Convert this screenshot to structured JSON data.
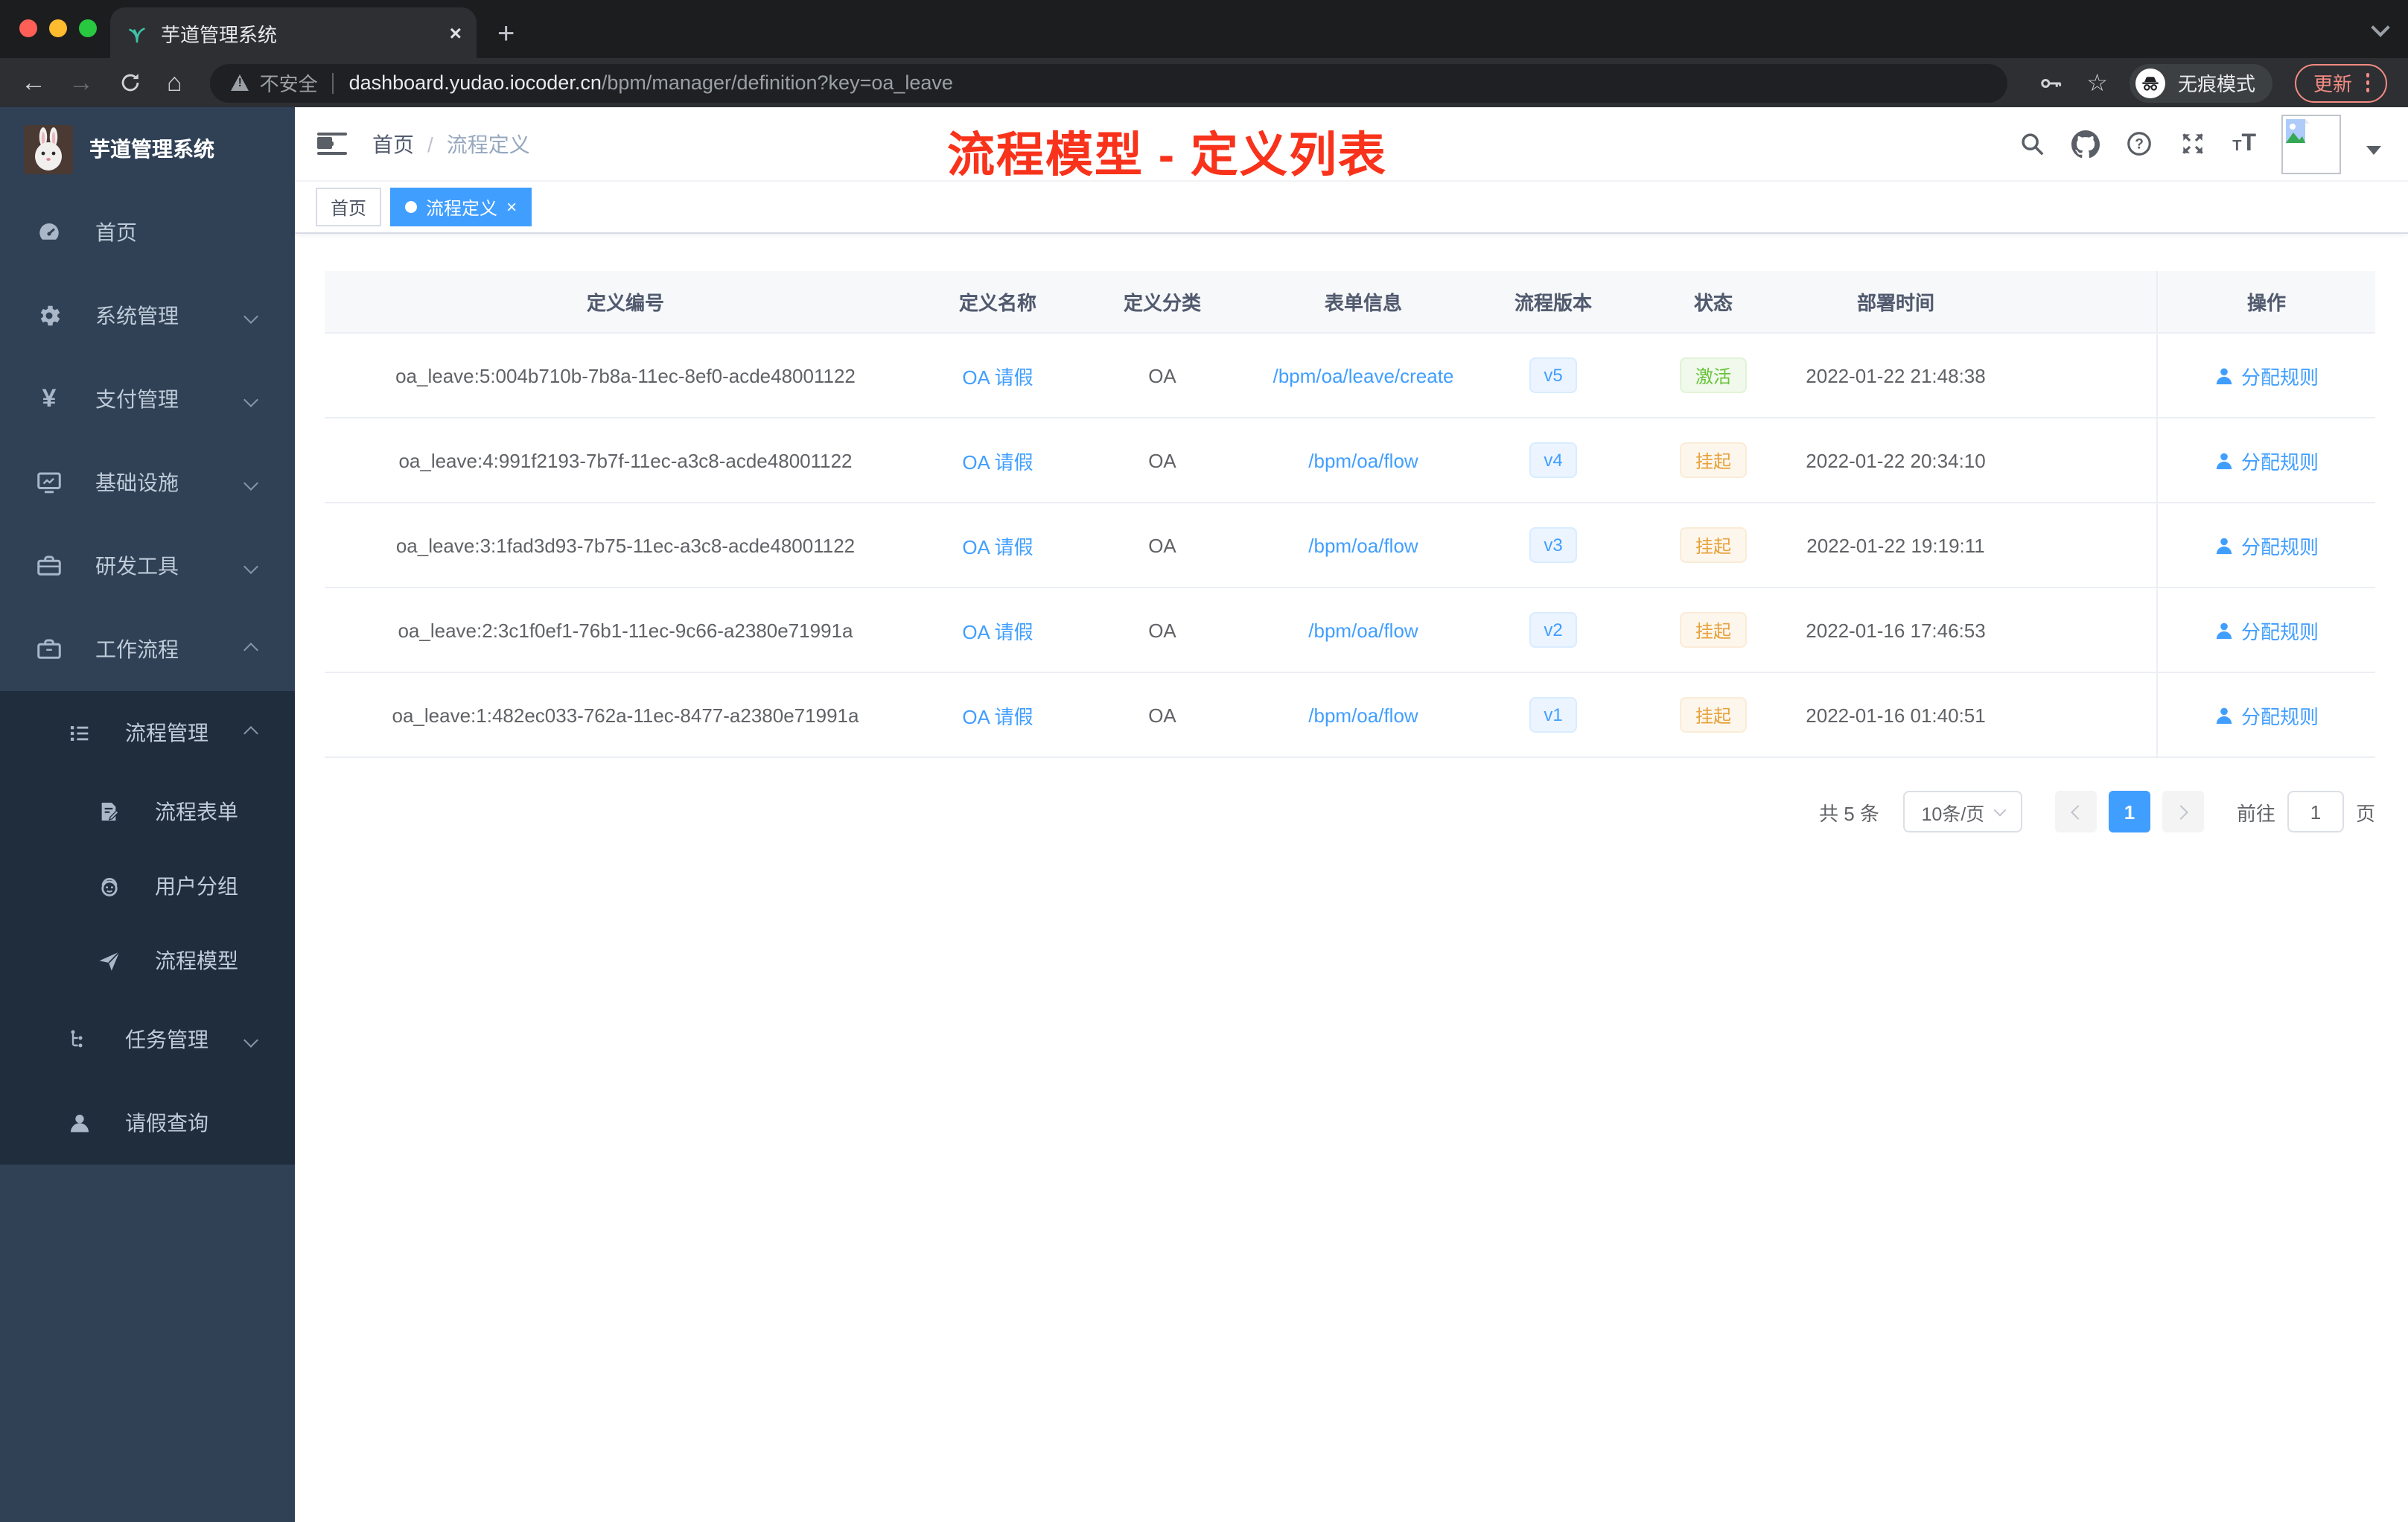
{
  "browser": {
    "tab_title": "芋道管理系统",
    "tab_close": "×",
    "new_tab": "+",
    "security_label": "不安全",
    "url_host": "dashboard.yudao.iocoder.cn",
    "url_path": "/bpm/manager/definition?key=oa_leave",
    "incognito_label": "无痕模式",
    "update_label": "更新"
  },
  "sidebar": {
    "title": "芋道管理系统",
    "items": [
      {
        "icon": "dashboard-icon",
        "label": "首页"
      },
      {
        "icon": "gear-icon",
        "label": "系统管理"
      },
      {
        "icon": "yen-icon",
        "label": "支付管理"
      },
      {
        "icon": "monitor-icon",
        "label": "基础设施"
      },
      {
        "icon": "toolbox-icon",
        "label": "研发工具"
      },
      {
        "icon": "briefcase-icon",
        "label": "工作流程"
      },
      {
        "icon": "list-icon",
        "label": "流程管理"
      },
      {
        "icon": "form-icon",
        "label": "流程表单"
      },
      {
        "icon": "group-icon",
        "label": "用户分组"
      },
      {
        "icon": "send-icon",
        "label": "流程模型"
      },
      {
        "icon": "tree-icon",
        "label": "任务管理"
      },
      {
        "icon": "user-icon",
        "label": "请假查询"
      }
    ]
  },
  "header": {
    "breadcrumb_home": "首页",
    "breadcrumb_sep": "/",
    "breadcrumb_current": "流程定义",
    "annotation": "流程模型 - 定义列表"
  },
  "tags": {
    "home": "首页",
    "active": "流程定义",
    "close": "×"
  },
  "table": {
    "columns": [
      "定义编号",
      "定义名称",
      "定义分类",
      "表单信息",
      "流程版本",
      "状态",
      "部署时间",
      "操作"
    ],
    "action_label": "分配规则",
    "rows": [
      {
        "id": "oa_leave:5:004b710b-7b8a-11ec-8ef0-acde48001122",
        "name": "OA 请假",
        "category": "OA",
        "form": "/bpm/oa/leave/create",
        "version": "v5",
        "status": "激活",
        "time": "2022-01-22 21:48:38"
      },
      {
        "id": "oa_leave:4:991f2193-7b7f-11ec-a3c8-acde48001122",
        "name": "OA 请假",
        "category": "OA",
        "form": "/bpm/oa/flow",
        "version": "v4",
        "status": "挂起",
        "time": "2022-01-22 20:34:10"
      },
      {
        "id": "oa_leave:3:1fad3d93-7b75-11ec-a3c8-acde48001122",
        "name": "OA 请假",
        "category": "OA",
        "form": "/bpm/oa/flow",
        "version": "v3",
        "status": "挂起",
        "time": "2022-01-22 19:19:11"
      },
      {
        "id": "oa_leave:2:3c1f0ef1-76b1-11ec-9c66-a2380e71991a",
        "name": "OA 请假",
        "category": "OA",
        "form": "/bpm/oa/flow",
        "version": "v2",
        "status": "挂起",
        "time": "2022-01-16 17:46:53"
      },
      {
        "id": "oa_leave:1:482ec033-762a-11ec-8477-a2380e71991a",
        "name": "OA 请假",
        "category": "OA",
        "form": "/bpm/oa/flow",
        "version": "v1",
        "status": "挂起",
        "time": "2022-01-16 01:40:51"
      }
    ]
  },
  "pagination": {
    "total": "共 5 条",
    "page_size": "10条/页",
    "current_page": "1",
    "goto_label": "前往",
    "goto_value": "1",
    "page_unit": "页"
  },
  "colors": {
    "primary": "#409eff",
    "success": "#67c23a",
    "warning": "#e6a23c",
    "annotation_red": "#f8321b",
    "update_red": "#f28b82",
    "sidebar_bg": "#304156",
    "sidebar_sub_bg": "#1f2d3d"
  }
}
